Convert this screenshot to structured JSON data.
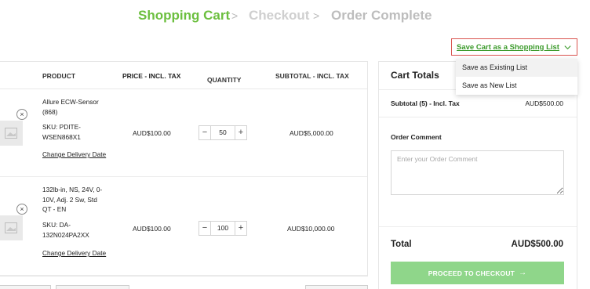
{
  "steps": {
    "current": "Shopping Cart",
    "separator1": ">",
    "next": "Checkout",
    "separator2": ">",
    "last": "Order Complete"
  },
  "save_cart": {
    "label": "Save Cart as a Shopping List",
    "icon": "chevron-down-icon",
    "options": [
      "Save as Existing List",
      "Save as New List"
    ]
  },
  "table": {
    "headers": {
      "product": "PRODUCT",
      "price": "PRICE - INCL. TAX",
      "quantity": "QUANTITY",
      "subtotal": "SUBTOTAL - INCL. TAX"
    },
    "items": [
      {
        "name": "Allure ECW-Sensor (868)",
        "sku": "SKU: PDITE-WSEN868X1",
        "link": "Change Delivery Date",
        "price": "AUD$100.00",
        "quantity": "50",
        "subtotal": "AUD$5,000.00"
      },
      {
        "name": "132lb-in, NS, 24V, 0-10V, Adj. 2 Sw, Std QT - EN",
        "sku": "SKU: DA-132N024PA2XX",
        "link": "Change Delivery Date",
        "price": "AUD$100.00",
        "quantity": "100",
        "subtotal": "AUD$10,000.00"
      }
    ],
    "qty_minus": "−",
    "qty_plus": "+",
    "remove": "×"
  },
  "totals": {
    "title": "Cart Totals",
    "subtotal_label": "Subtotal (5) - Incl. Tax",
    "subtotal_value": "AUD$500.00",
    "comment_label": "Order Comment",
    "comment_placeholder": "Enter your Order Comment",
    "total_label": "Total",
    "total_value": "AUD$500.00",
    "checkout_label": "PROCEED TO CHECKOUT",
    "checkout_arrow": "→"
  },
  "colors": {
    "brand_green": "#6cbf3f",
    "link_green": "#3a9a2a",
    "checkout_button": "#8fd68a",
    "highlight_border": "#d9534f"
  }
}
